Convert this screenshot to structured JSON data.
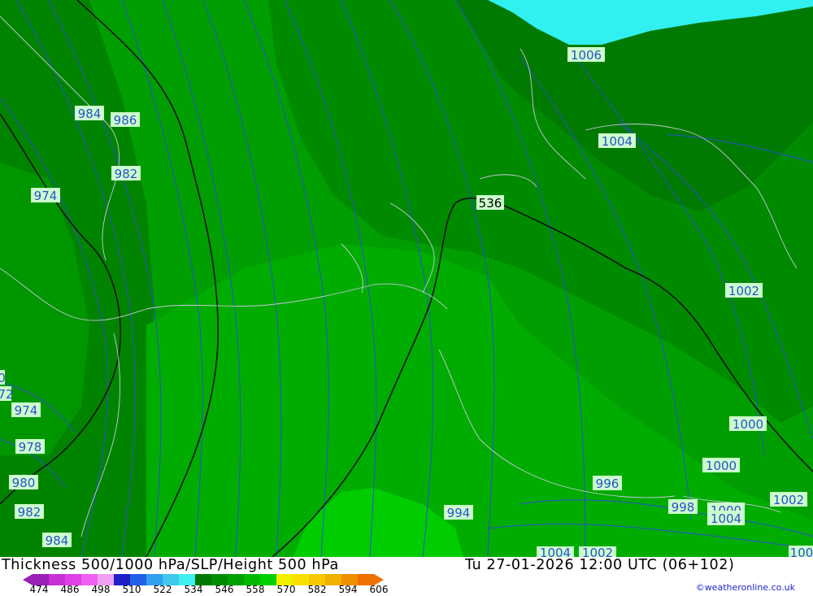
{
  "map": {
    "thickness_label": "536",
    "isobar_labels": [
      "1006",
      "1004",
      "1002",
      "1000",
      "1000",
      "996",
      "994",
      "998",
      "1000",
      "1004",
      "1002",
      "1004",
      "1002",
      "984",
      "986",
      "982",
      "974",
      "974",
      "978",
      "980",
      "982",
      "984",
      "72",
      "0",
      "100"
    ]
  },
  "footer": {
    "title_left": "Thickness 500/1000 hPa/SLP/Height 500 hPa",
    "title_right": "Tu 27-01-2026 12:00 UTC (06+102)",
    "credit": "©weatheronline.co.uk",
    "scale_ticks": [
      "474",
      "486",
      "498",
      "510",
      "522",
      "534",
      "546",
      "558",
      "570",
      "582",
      "594",
      "606"
    ],
    "scale_colors": [
      "#9b20b8",
      "#c830d8",
      "#e040e8",
      "#f060f0",
      "#f0a0f0",
      "#2020c8",
      "#2060e8",
      "#30a0f0",
      "#40c8f0",
      "#40f0f0",
      "#007800",
      "#008c00",
      "#00a000",
      "#00b800",
      "#00d000",
      "#f0f000",
      "#f8e000",
      "#f8c800",
      "#f0b000",
      "#f09000",
      "#f07000"
    ]
  }
}
